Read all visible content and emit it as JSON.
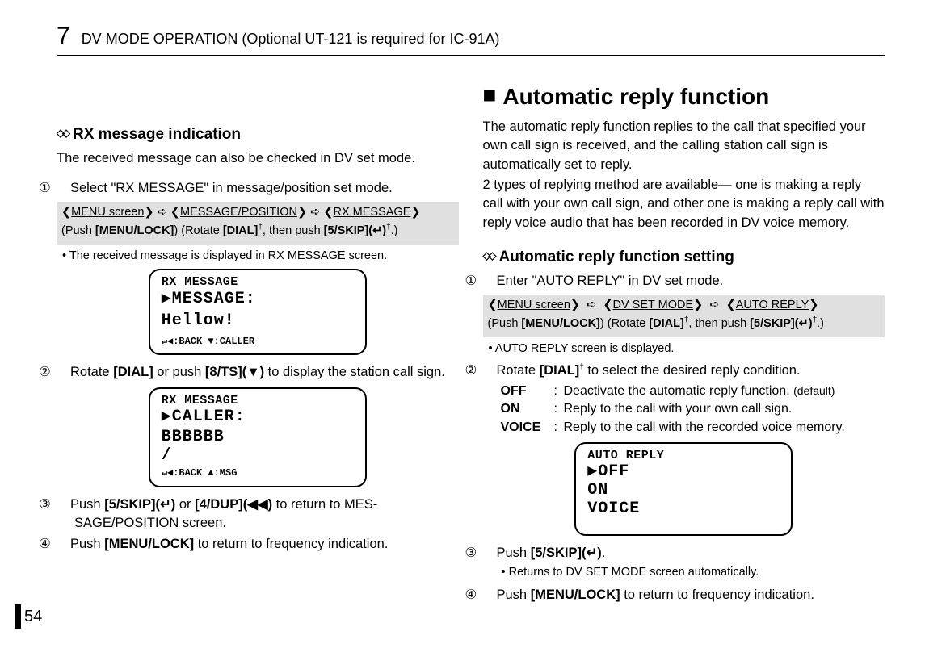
{
  "chapter": {
    "num": "7",
    "title": "DV MODE OPERATION (Optional UT-121 is required for IC-91A)"
  },
  "left": {
    "sec1_diamond": "◇◇",
    "sec1_title": "RX message indication",
    "sec1_lead": "The received message can also be checked in DV set mode.",
    "step1_circ": "①",
    "step1": "Select \"RX MESSAGE\" in message/position set mode.",
    "shaded1_line1_a": "MENU screen",
    "shaded1_line1_b": "MESSAGE/POSITION",
    "shaded1_line1_c": "RX MESSAGE",
    "shaded1_line2_a": "(Push ",
    "shaded1_line2_b": "[MENU/LOCK]",
    "shaded1_line2_c": ")  (Rotate ",
    "shaded1_line2_d": "[DIAL]",
    "shaded1_line2_e": ", then push ",
    "shaded1_line2_f": "[5/SKIP](↵)",
    "shaded1_line2_g": ".)",
    "shaded1_sup": "†",
    "bullet1": "• The received message is displayed in RX MESSAGE screen.",
    "lcd1": {
      "l1": "RX MESSAGE",
      "l2": "▶MESSAGE:",
      "l3": " Hellow!",
      "l4": "↵◀:BACK ▼:CALLER"
    },
    "step2_circ": "②",
    "step2_a": "Rotate ",
    "step2_b": "[DIAL]",
    "step2_c": " or push ",
    "step2_d": "[8/TS](▼)",
    "step2_e": " to display the station call sign.",
    "lcd2": {
      "l1": "RX MESSAGE",
      "l2": "▶CALLER:",
      "l3": " BBBBBB",
      "l4": " /",
      "l5": "↵◀:BACK ▲:MSG"
    },
    "step3_circ": "③",
    "step3_a": "Push ",
    "step3_b": "[5/SKIP](↵)",
    "step3_c": " or ",
    "step3_d": "[4/DUP](◀◀)",
    "step3_e": " to return to MES-SAGE/POSITION screen.",
    "step4_circ": "④",
    "step4_a": "Push ",
    "step4_b": "[MENU/LOCK]",
    "step4_c": " to return to frequency indication."
  },
  "right": {
    "h_square": "■",
    "h_title": "Automatic reply function",
    "p1": "The automatic reply function replies to the call that specified your own call sign is received, and the calling station call sign is automatically set to reply.",
    "p2": "2 types of replying method are available— one is making a reply call with your own call sign, and other one is making a reply call with reply voice audio that has been recorded in DV voice memory.",
    "sec2_diamond": "◇◇",
    "sec2_title": "Automatic reply function setting",
    "step1_circ": "①",
    "step1": "Enter \"AUTO REPLY\" in DV set mode.",
    "shaded2_line1_a": "MENU screen",
    "shaded2_line1_b": "DV SET MODE",
    "shaded2_line1_c": "AUTO REPLY",
    "shaded2_line2_a": "(Push ",
    "shaded2_line2_b": "[MENU/LOCK]",
    "shaded2_line2_c": ")  (Rotate ",
    "shaded2_line2_d": "[DIAL]",
    "shaded2_line2_e": ", then push ",
    "shaded2_line2_f": "[5/SKIP](↵)",
    "shaded2_line2_g": ".)",
    "shaded2_sup": "†",
    "bullet1": "• AUTO REPLY screen is displayed.",
    "step2_circ": "②",
    "step2_a": "Rotate ",
    "step2_b": "[DIAL]",
    "step2_sup": "†",
    "step2_c": " to select the desired reply condition.",
    "defs": [
      {
        "k": "OFF",
        "v": "Deactivate the automatic reply function. ",
        "small": "(default)"
      },
      {
        "k": "ON",
        "v": "Reply to the call with your own call sign."
      },
      {
        "k": "VOICE",
        "v": "Reply to the call with the recorded voice memory."
      }
    ],
    "lcd3": {
      "l1": "AUTO REPLY",
      "l2": "▶OFF",
      "l3": " ON",
      "l4": " VOICE"
    },
    "step3_circ": "③",
    "step3_a": "Push ",
    "step3_b": "[5/SKIP](↵)",
    "step3_c": ".",
    "bullet3": "• Returns to DV SET MODE screen automatically.",
    "step4_circ": "④",
    "step4_a": "Push ",
    "step4_b": "[MENU/LOCK]",
    "step4_c": " to return to frequency indication."
  },
  "page_num": "54"
}
